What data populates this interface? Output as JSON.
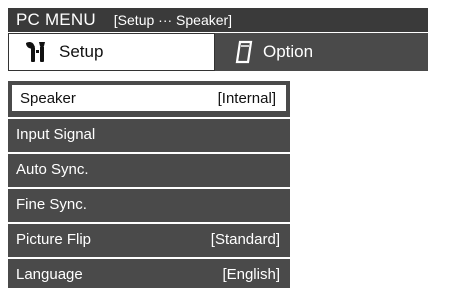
{
  "title_bar": {
    "menu_name": "PC MENU",
    "breadcrumb": "[Setup ··· Speaker]"
  },
  "tabs": [
    {
      "label": "Setup",
      "icon": "setup-tool-icon",
      "active": true
    },
    {
      "label": "Option",
      "icon": "option-card-icon",
      "active": false
    }
  ],
  "menu": {
    "items": [
      {
        "label": "Speaker",
        "value": "[Internal]",
        "selected": true
      },
      {
        "label": "Input Signal",
        "value": ""
      },
      {
        "label": "Auto Sync.",
        "value": ""
      },
      {
        "label": "Fine Sync.",
        "value": ""
      },
      {
        "label": "Picture Flip",
        "value": "[Standard]"
      },
      {
        "label": "Language",
        "value": "[English]"
      }
    ]
  },
  "colors": {
    "panel": "#4a4a4a",
    "title_bar": "#3a3a3a",
    "highlight": "#ffffff"
  }
}
